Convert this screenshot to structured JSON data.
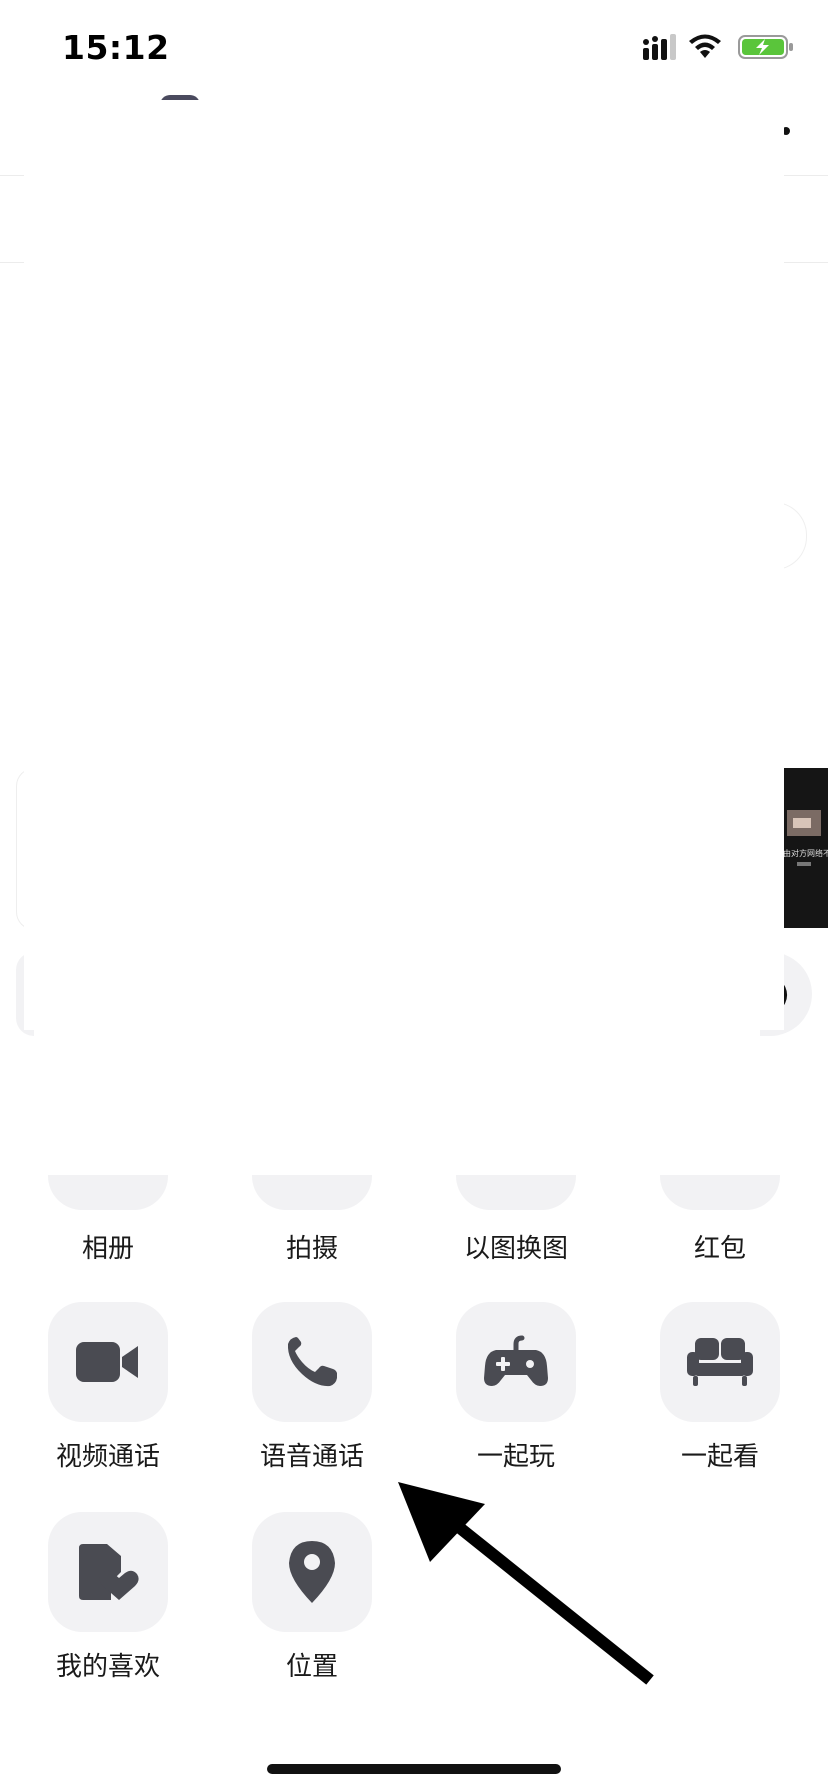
{
  "status_bar": {
    "time": "15:12",
    "icons": [
      "signal-icon",
      "wifi-icon",
      "battery-charging-icon"
    ],
    "battery_color": "#5ac53b"
  },
  "media_preview": {
    "caption": "由对方网络不佳"
  },
  "panel": {
    "row1": [
      {
        "label": "相册",
        "icon": "album-icon"
      },
      {
        "label": "拍摄",
        "icon": "camera-icon"
      },
      {
        "label": "以图换图",
        "icon": "image-swap-icon"
      },
      {
        "label": "红包",
        "icon": "red-packet-icon"
      }
    ],
    "row2": [
      {
        "label": "视频通话",
        "icon": "video-call-icon"
      },
      {
        "label": "语音通话",
        "icon": "phone-icon"
      },
      {
        "label": "一起玩",
        "icon": "gamepad-icon"
      },
      {
        "label": "一起看",
        "icon": "sofa-icon"
      }
    ],
    "row3": [
      {
        "label": "我的喜欢",
        "icon": "favorite-folder-icon"
      },
      {
        "label": "位置",
        "icon": "location-pin-icon"
      }
    ]
  },
  "colors": {
    "tile_background": "#f2f2f4",
    "icon_color": "#4a4b52",
    "annotation_arrow": "#000000"
  }
}
